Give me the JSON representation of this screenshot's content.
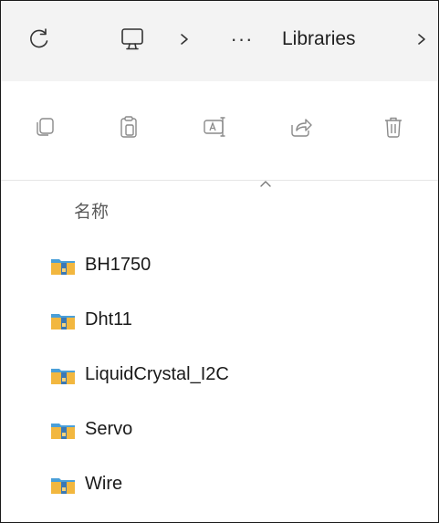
{
  "address_bar": {
    "more_label": "···",
    "crumb": "Libraries",
    "separator": ">",
    "icons": [
      "refresh-icon",
      "this-pc-icon",
      "chevron-right-icon"
    ]
  },
  "command_bar": {
    "icons": [
      "copy-icon",
      "paste-icon",
      "rename-icon",
      "share-icon",
      "delete-icon"
    ]
  },
  "list": {
    "column_name": "名称",
    "sort": "ascending",
    "items": [
      "BH1750",
      "Dht11",
      "LiquidCrystal_I2C",
      "Servo",
      "Wire"
    ]
  },
  "colors": {
    "folder_yellow": "#f2b73f",
    "folder_blue": "#4a9fd8",
    "icon_gray": "#8a8a8a"
  }
}
